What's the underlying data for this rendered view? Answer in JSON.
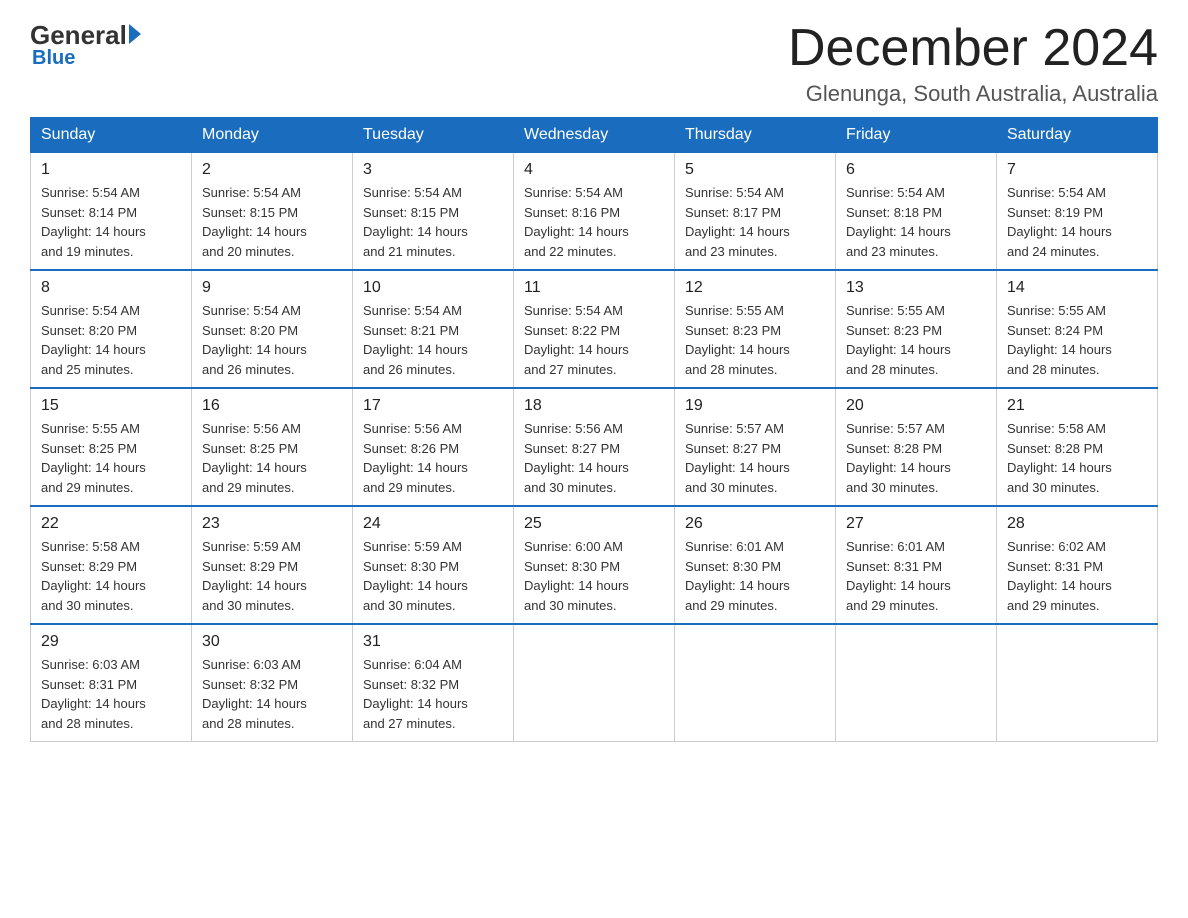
{
  "header": {
    "logo_general": "General",
    "logo_blue": "Blue",
    "month_title": "December 2024",
    "location": "Glenunga, South Australia, Australia"
  },
  "weekdays": [
    "Sunday",
    "Monday",
    "Tuesday",
    "Wednesday",
    "Thursday",
    "Friday",
    "Saturday"
  ],
  "weeks": [
    [
      {
        "day": "1",
        "sunrise": "5:54 AM",
        "sunset": "8:14 PM",
        "daylight": "14 hours and 19 minutes."
      },
      {
        "day": "2",
        "sunrise": "5:54 AM",
        "sunset": "8:15 PM",
        "daylight": "14 hours and 20 minutes."
      },
      {
        "day": "3",
        "sunrise": "5:54 AM",
        "sunset": "8:15 PM",
        "daylight": "14 hours and 21 minutes."
      },
      {
        "day": "4",
        "sunrise": "5:54 AM",
        "sunset": "8:16 PM",
        "daylight": "14 hours and 22 minutes."
      },
      {
        "day": "5",
        "sunrise": "5:54 AM",
        "sunset": "8:17 PM",
        "daylight": "14 hours and 23 minutes."
      },
      {
        "day": "6",
        "sunrise": "5:54 AM",
        "sunset": "8:18 PM",
        "daylight": "14 hours and 23 minutes."
      },
      {
        "day": "7",
        "sunrise": "5:54 AM",
        "sunset": "8:19 PM",
        "daylight": "14 hours and 24 minutes."
      }
    ],
    [
      {
        "day": "8",
        "sunrise": "5:54 AM",
        "sunset": "8:20 PM",
        "daylight": "14 hours and 25 minutes."
      },
      {
        "day": "9",
        "sunrise": "5:54 AM",
        "sunset": "8:20 PM",
        "daylight": "14 hours and 26 minutes."
      },
      {
        "day": "10",
        "sunrise": "5:54 AM",
        "sunset": "8:21 PM",
        "daylight": "14 hours and 26 minutes."
      },
      {
        "day": "11",
        "sunrise": "5:54 AM",
        "sunset": "8:22 PM",
        "daylight": "14 hours and 27 minutes."
      },
      {
        "day": "12",
        "sunrise": "5:55 AM",
        "sunset": "8:23 PM",
        "daylight": "14 hours and 28 minutes."
      },
      {
        "day": "13",
        "sunrise": "5:55 AM",
        "sunset": "8:23 PM",
        "daylight": "14 hours and 28 minutes."
      },
      {
        "day": "14",
        "sunrise": "5:55 AM",
        "sunset": "8:24 PM",
        "daylight": "14 hours and 28 minutes."
      }
    ],
    [
      {
        "day": "15",
        "sunrise": "5:55 AM",
        "sunset": "8:25 PM",
        "daylight": "14 hours and 29 minutes."
      },
      {
        "day": "16",
        "sunrise": "5:56 AM",
        "sunset": "8:25 PM",
        "daylight": "14 hours and 29 minutes."
      },
      {
        "day": "17",
        "sunrise": "5:56 AM",
        "sunset": "8:26 PM",
        "daylight": "14 hours and 29 minutes."
      },
      {
        "day": "18",
        "sunrise": "5:56 AM",
        "sunset": "8:27 PM",
        "daylight": "14 hours and 30 minutes."
      },
      {
        "day": "19",
        "sunrise": "5:57 AM",
        "sunset": "8:27 PM",
        "daylight": "14 hours and 30 minutes."
      },
      {
        "day": "20",
        "sunrise": "5:57 AM",
        "sunset": "8:28 PM",
        "daylight": "14 hours and 30 minutes."
      },
      {
        "day": "21",
        "sunrise": "5:58 AM",
        "sunset": "8:28 PM",
        "daylight": "14 hours and 30 minutes."
      }
    ],
    [
      {
        "day": "22",
        "sunrise": "5:58 AM",
        "sunset": "8:29 PM",
        "daylight": "14 hours and 30 minutes."
      },
      {
        "day": "23",
        "sunrise": "5:59 AM",
        "sunset": "8:29 PM",
        "daylight": "14 hours and 30 minutes."
      },
      {
        "day": "24",
        "sunrise": "5:59 AM",
        "sunset": "8:30 PM",
        "daylight": "14 hours and 30 minutes."
      },
      {
        "day": "25",
        "sunrise": "6:00 AM",
        "sunset": "8:30 PM",
        "daylight": "14 hours and 30 minutes."
      },
      {
        "day": "26",
        "sunrise": "6:01 AM",
        "sunset": "8:30 PM",
        "daylight": "14 hours and 29 minutes."
      },
      {
        "day": "27",
        "sunrise": "6:01 AM",
        "sunset": "8:31 PM",
        "daylight": "14 hours and 29 minutes."
      },
      {
        "day": "28",
        "sunrise": "6:02 AM",
        "sunset": "8:31 PM",
        "daylight": "14 hours and 29 minutes."
      }
    ],
    [
      {
        "day": "29",
        "sunrise": "6:03 AM",
        "sunset": "8:31 PM",
        "daylight": "14 hours and 28 minutes."
      },
      {
        "day": "30",
        "sunrise": "6:03 AM",
        "sunset": "8:32 PM",
        "daylight": "14 hours and 28 minutes."
      },
      {
        "day": "31",
        "sunrise": "6:04 AM",
        "sunset": "8:32 PM",
        "daylight": "14 hours and 27 minutes."
      },
      null,
      null,
      null,
      null
    ]
  ],
  "labels": {
    "sunrise": "Sunrise:",
    "sunset": "Sunset:",
    "daylight": "Daylight:"
  }
}
